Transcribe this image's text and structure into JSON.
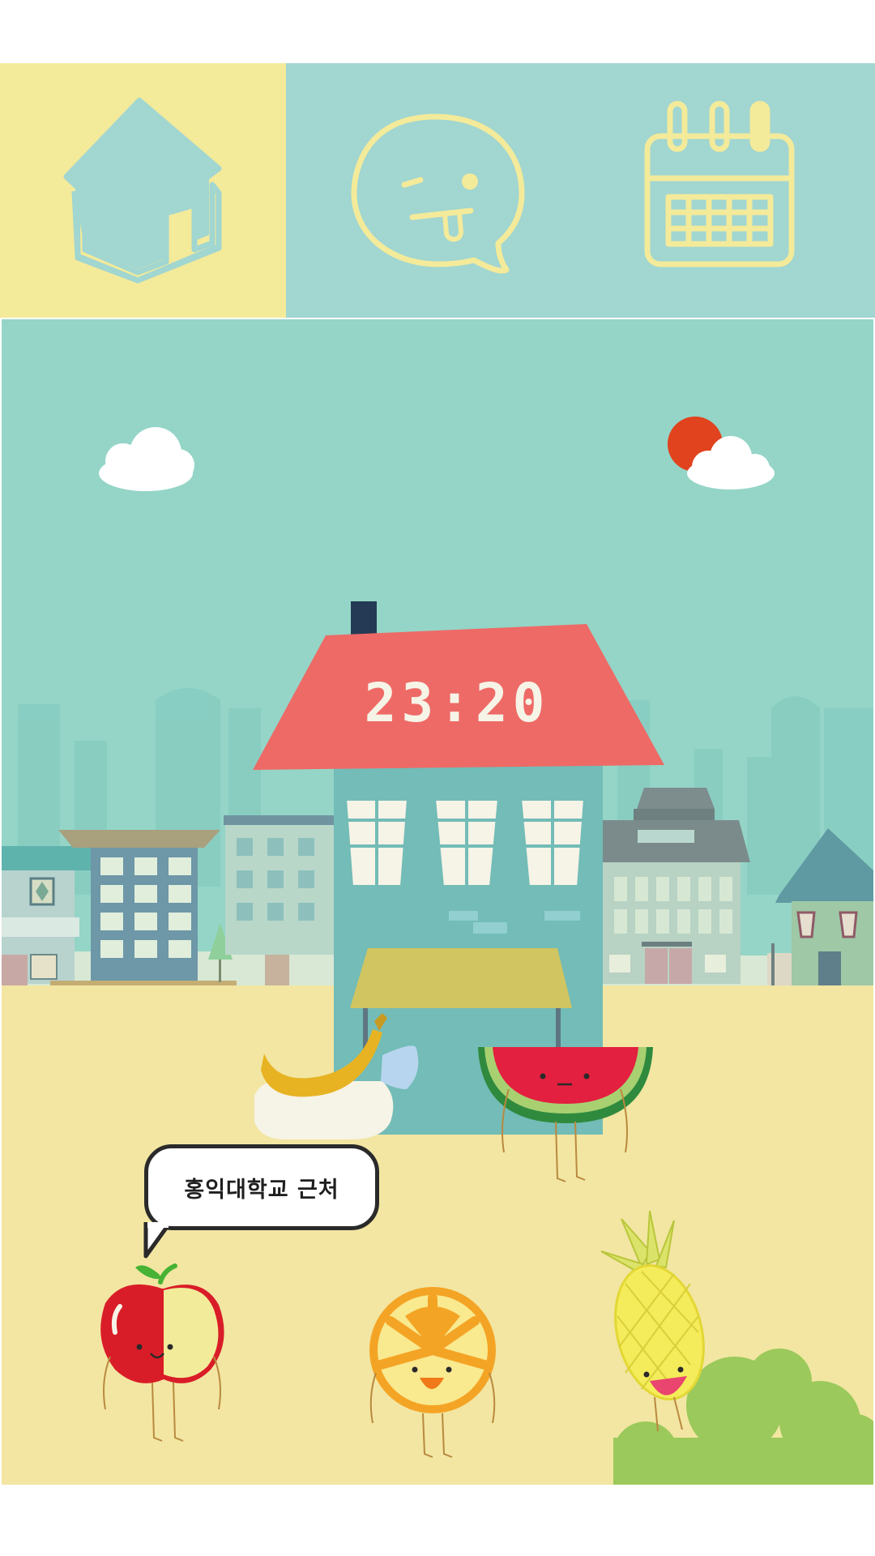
{
  "tabs": [
    {
      "id": "home",
      "icon": "house-icon",
      "selected": true
    },
    {
      "id": "chat",
      "icon": "winking-speech-bubble-icon",
      "selected": false
    },
    {
      "id": "calendar",
      "icon": "calendar-icon",
      "selected": false
    }
  ],
  "scene": {
    "clock_time": "23:20",
    "location_bubble": "홍익대학교 근처",
    "characters": [
      "banana",
      "watermelon",
      "apple",
      "orange",
      "pineapple"
    ],
    "weather_icon": "sun-behind-cloud-icon"
  },
  "colors": {
    "tab_selected_bg": "#f3ea9a",
    "tab_bg": "#a1d6d1",
    "icon_selected": "#a1d6d1",
    "icon_default": "#f3ea9a",
    "sky": "#94d5c7",
    "ground": "#f2e6a2",
    "roof": "#ee6a66",
    "house_wall": "#73bcb7"
  }
}
